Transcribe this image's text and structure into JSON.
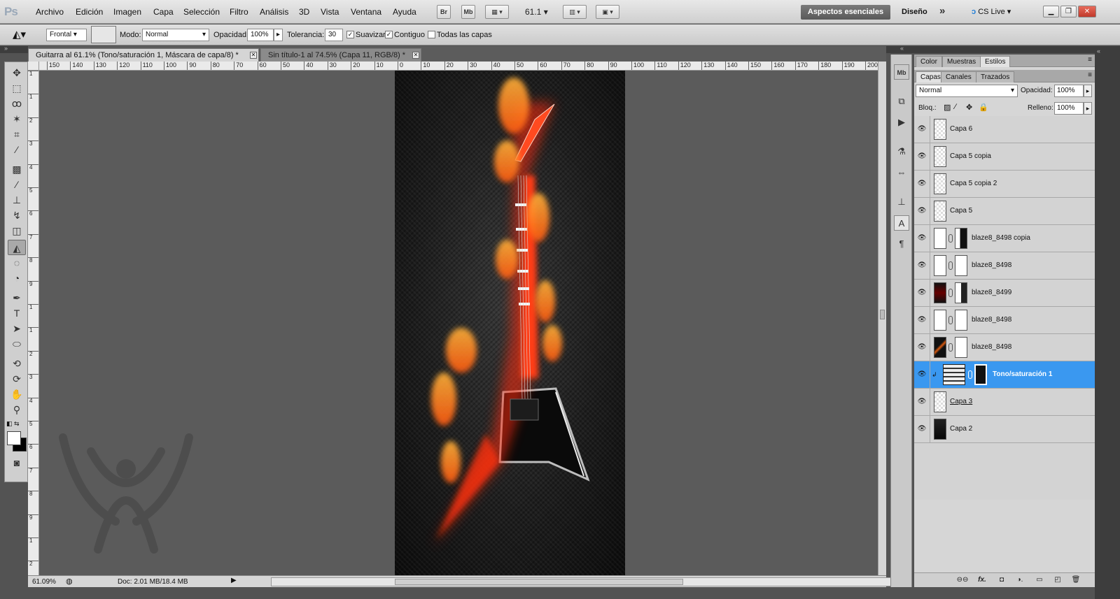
{
  "app": {
    "logo": "Ps"
  },
  "menu": {
    "items": [
      "Archivo",
      "Edición",
      "Imagen",
      "Capa",
      "Selección",
      "Filtro",
      "Análisis",
      "3D",
      "Vista",
      "Ventana",
      "Ayuda"
    ],
    "bridge_label": "Br",
    "minibridge_label": "Mb",
    "zoom_value": "61.1",
    "workspace_active": "Aspectos esenciales",
    "workspace_other": "Diseño",
    "more_label": "»",
    "cslive_label": "CS Live"
  },
  "options": {
    "preset_label": "Frontal",
    "mode_label": "Modo:",
    "mode_value": "Normal",
    "opacity_label": "Opacidad:",
    "opacity_value": "100%",
    "tolerance_label": "Tolerancia:",
    "tolerance_value": "30",
    "smooth_label": "Suavizar",
    "smooth_checked": true,
    "contiguous_label": "Contiguo",
    "contiguous_checked": true,
    "all_layers_label": "Todas las capas",
    "all_layers_checked": false
  },
  "documents": {
    "tabs": [
      {
        "label": "Guitarra al 61.1% (Tono/saturación 1, Máscara de capa/8) *",
        "active": true
      },
      {
        "label": "Sin título-1 al 74.5% (Capa 11, RGB/8) *",
        "active": false
      }
    ]
  },
  "rulers": {
    "h": [
      "150",
      "140",
      "130",
      "120",
      "110",
      "100",
      "90",
      "80",
      "70",
      "60",
      "50",
      "40",
      "30",
      "20",
      "10",
      "0",
      "10",
      "20",
      "30",
      "40",
      "50",
      "60",
      "70",
      "80",
      "90",
      "100",
      "110",
      "120",
      "130",
      "140",
      "150",
      "160",
      "170",
      "180",
      "190",
      "200"
    ],
    "v": [
      "1",
      "1",
      "2",
      "3",
      "4",
      "5",
      "6",
      "7",
      "8",
      "9",
      "1",
      "1",
      "2",
      "3",
      "4",
      "5",
      "6",
      "7",
      "8",
      "9",
      "1",
      "2"
    ]
  },
  "status": {
    "zoom": "61.09%",
    "doc": "Doc: 2.01 MB/18.4 MB"
  },
  "panels": {
    "top_tabs": [
      "Color",
      "Muestras",
      "Estilos"
    ],
    "top_active": "Estilos",
    "layer_tabs": [
      "Capas",
      "Canales",
      "Trazados"
    ],
    "layer_active": "Capas",
    "blend_mode": "Normal",
    "opacity_label": "Opacidad:",
    "opacity_value": "100%",
    "lock_label": "Bloq.:",
    "fill_label": "Relleno:",
    "fill_value": "100%"
  },
  "layers": [
    {
      "name": "Capa 6",
      "thumb": "transparent",
      "mask": false,
      "selected": false
    },
    {
      "name": "Capa 5 copia",
      "thumb": "transparent",
      "mask": false,
      "selected": false
    },
    {
      "name": "Capa 5 copia 2",
      "thumb": "transparent",
      "mask": false,
      "selected": false
    },
    {
      "name": "Capa 5",
      "thumb": "transparent",
      "mask": false,
      "selected": false
    },
    {
      "name": "blaze8_8498 copia",
      "thumb": "mask",
      "mask": true,
      "selected": false
    },
    {
      "name": "blaze8_8498",
      "thumb": "mask",
      "mask": true,
      "selected": false
    },
    {
      "name": "blaze8_8499",
      "thumb": "mask",
      "mask": true,
      "selected": false
    },
    {
      "name": "blaze8_8498",
      "thumb": "mask",
      "mask": true,
      "selected": false
    },
    {
      "name": "blaze8_8498",
      "thumb": "mask",
      "mask": true,
      "selected": false
    },
    {
      "name": "Tono/saturación 1",
      "thumb": "adjustment",
      "mask": true,
      "selected": true
    },
    {
      "name": "Capa 3",
      "thumb": "transparent",
      "mask": false,
      "selected": false
    },
    {
      "name": "Capa 2",
      "thumb": "dark",
      "mask": false,
      "selected": false
    }
  ],
  "colors": {
    "selection": "#3a98f0",
    "flame": "#ff3a1a",
    "canvas_bg": "#5b5b5b"
  }
}
